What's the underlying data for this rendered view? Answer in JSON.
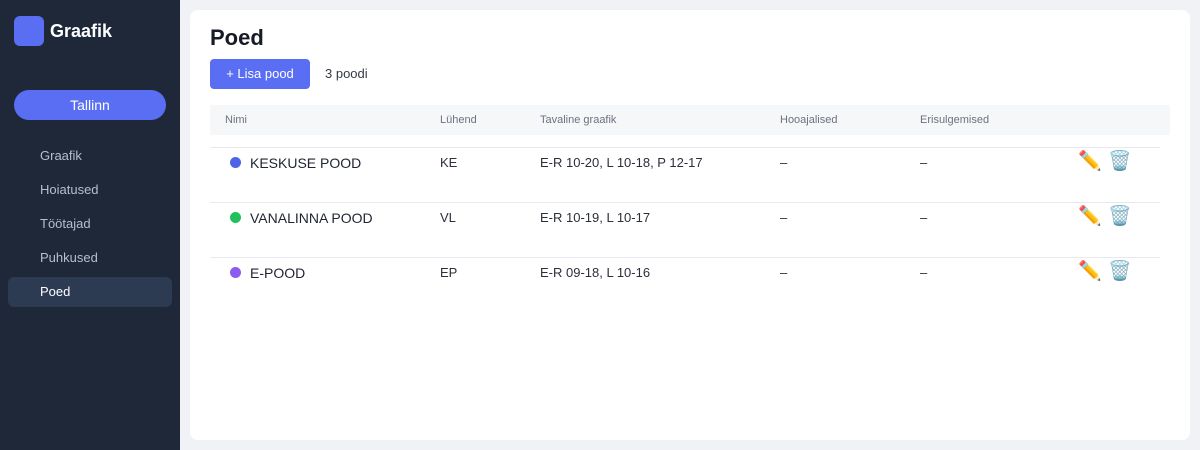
{
  "app": {
    "name": "Graafik",
    "accent": "#5a6ef4"
  },
  "sidebar": {
    "city": "Tallinn",
    "items": [
      {
        "label": "Graafik",
        "active": false
      },
      {
        "label": "Hoiatused",
        "active": false
      },
      {
        "label": "Töötajad",
        "active": false
      },
      {
        "label": "Puhkused",
        "active": false
      },
      {
        "label": "Poed",
        "active": true
      }
    ]
  },
  "main": {
    "title": "Poed",
    "add_label": "+ Lisa pood",
    "count": "3 poodi",
    "columns": [
      "Nimi",
      "Lühend",
      "Tavaline graafik",
      "Hooajalised",
      "Erisulgemised"
    ],
    "stores": [
      {
        "name": "KESKUSE POOD",
        "abbr": "KE",
        "schedule": "E-R 10-20, L 10-18, P 12-17",
        "seasonal": "–",
        "closures": "–",
        "color": "#4f63e8"
      },
      {
        "name": "VANALINNA POOD",
        "abbr": "VL",
        "schedule": "E-R 10-19, L 10-17",
        "seasonal": "–",
        "closures": "–",
        "color": "#22c05a"
      },
      {
        "name": "E-POOD",
        "abbr": "EP",
        "schedule": "E-R 09-18, L 10-16",
        "seasonal": "–",
        "closures": "–",
        "color": "#8b5cf0"
      }
    ],
    "icons": {
      "edit": "pencil-icon",
      "delete": "trash-icon"
    }
  }
}
